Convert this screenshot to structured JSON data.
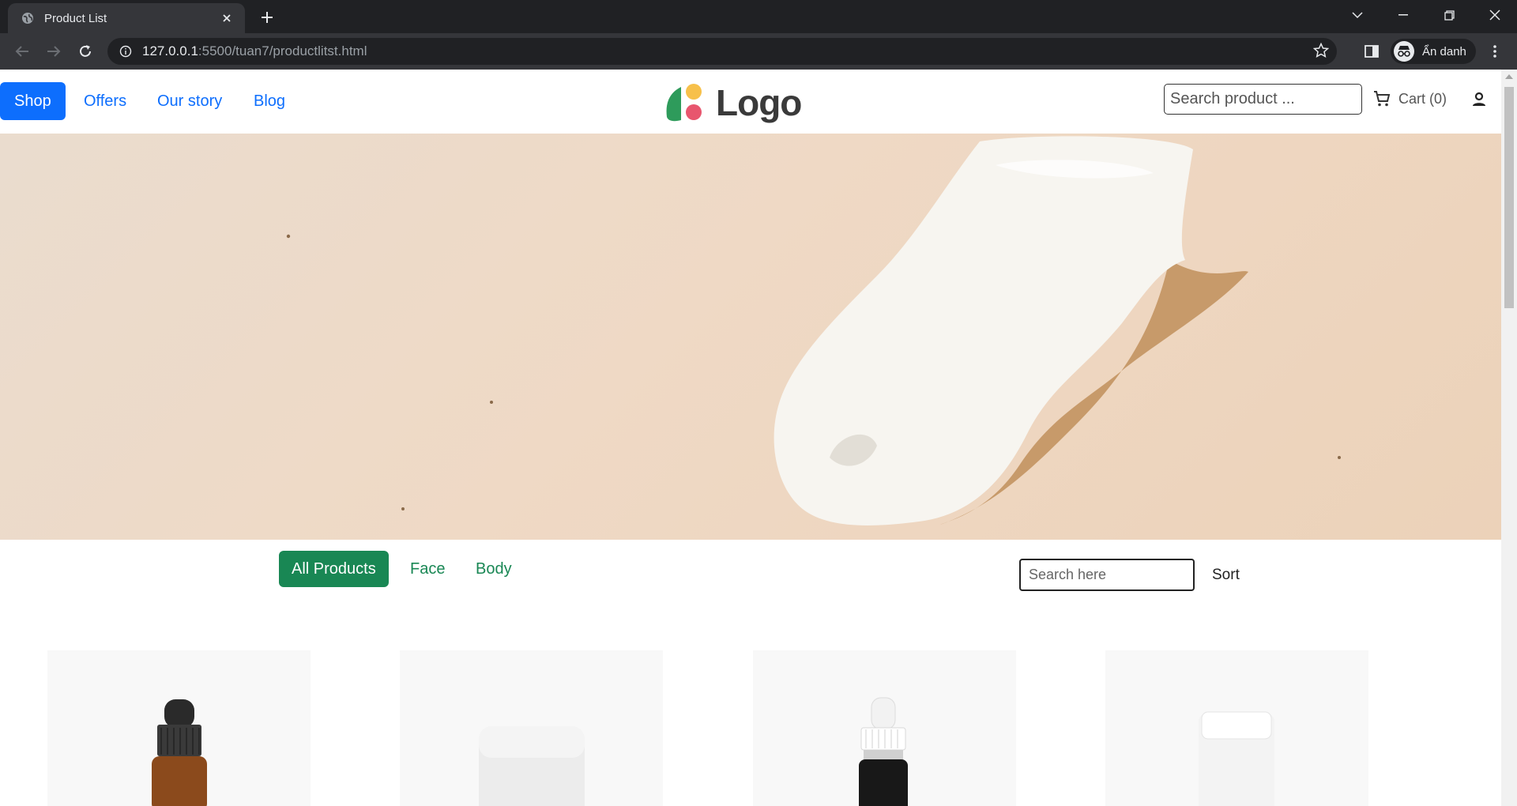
{
  "browser": {
    "tab_title": "Product List",
    "url_host": "127.0.0.1",
    "url_path": ":5500/tuan7/productlitst.html",
    "profile_label": "Ẩn danh",
    "icons": [
      "globe-icon",
      "close-icon",
      "plus-icon",
      "chevron-down-icon",
      "minimize-icon",
      "restore-icon",
      "window-close-icon",
      "back-icon",
      "forward-icon",
      "reload-icon",
      "info-icon",
      "star-icon",
      "sidebar-icon",
      "incognito-icon",
      "kebab-menu-icon"
    ]
  },
  "header": {
    "nav": [
      {
        "label": "Shop",
        "active": true
      },
      {
        "label": "Offers",
        "active": false
      },
      {
        "label": "Our story",
        "active": false
      },
      {
        "label": "Blog",
        "active": false
      }
    ],
    "logo_text": "Logo",
    "search_placeholder": "Search product ...",
    "cart_label": "Cart (0)",
    "colors": {
      "primary": "#0d6efd",
      "logo_green": "#2e9b5b",
      "logo_yellow": "#f7c04a",
      "logo_pink": "#e8566e"
    }
  },
  "filters": {
    "tabs": [
      {
        "label": "All Products",
        "active": true
      },
      {
        "label": "Face",
        "active": false
      },
      {
        "label": "Body",
        "active": false
      }
    ],
    "search_placeholder": "Search here",
    "sort_label": "Sort",
    "accent": "#198754"
  },
  "products": [
    {
      "image": "amber-dropper-bottle"
    },
    {
      "image": "white-jar"
    },
    {
      "image": "black-dropper-bottle"
    },
    {
      "image": "white-tube"
    }
  ]
}
